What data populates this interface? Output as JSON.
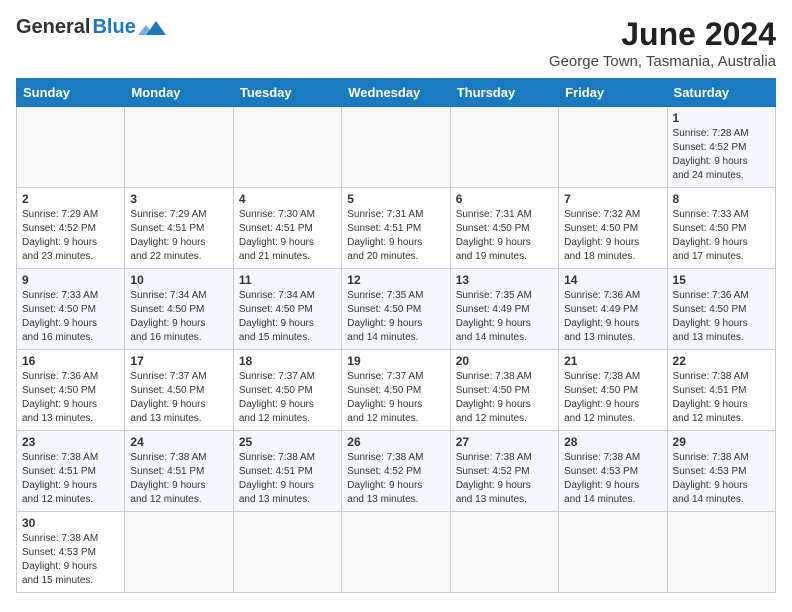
{
  "header": {
    "logo_general": "General",
    "logo_blue": "Blue",
    "title": "June 2024",
    "subtitle": "George Town, Tasmania, Australia"
  },
  "weekdays": [
    "Sunday",
    "Monday",
    "Tuesday",
    "Wednesday",
    "Thursday",
    "Friday",
    "Saturday"
  ],
  "weeks": [
    [
      {
        "day": "",
        "info": ""
      },
      {
        "day": "",
        "info": ""
      },
      {
        "day": "",
        "info": ""
      },
      {
        "day": "",
        "info": ""
      },
      {
        "day": "",
        "info": ""
      },
      {
        "day": "",
        "info": ""
      },
      {
        "day": "1",
        "info": "Sunrise: 7:28 AM\nSunset: 4:52 PM\nDaylight: 9 hours\nand 24 minutes."
      }
    ],
    [
      {
        "day": "2",
        "info": "Sunrise: 7:29 AM\nSunset: 4:52 PM\nDaylight: 9 hours\nand 23 minutes."
      },
      {
        "day": "3",
        "info": "Sunrise: 7:29 AM\nSunset: 4:51 PM\nDaylight: 9 hours\nand 22 minutes."
      },
      {
        "day": "4",
        "info": "Sunrise: 7:30 AM\nSunset: 4:51 PM\nDaylight: 9 hours\nand 21 minutes."
      },
      {
        "day": "5",
        "info": "Sunrise: 7:31 AM\nSunset: 4:51 PM\nDaylight: 9 hours\nand 20 minutes."
      },
      {
        "day": "6",
        "info": "Sunrise: 7:31 AM\nSunset: 4:50 PM\nDaylight: 9 hours\nand 19 minutes."
      },
      {
        "day": "7",
        "info": "Sunrise: 7:32 AM\nSunset: 4:50 PM\nDaylight: 9 hours\nand 18 minutes."
      },
      {
        "day": "8",
        "info": "Sunrise: 7:33 AM\nSunset: 4:50 PM\nDaylight: 9 hours\nand 17 minutes."
      }
    ],
    [
      {
        "day": "9",
        "info": "Sunrise: 7:33 AM\nSunset: 4:50 PM\nDaylight: 9 hours\nand 16 minutes."
      },
      {
        "day": "10",
        "info": "Sunrise: 7:34 AM\nSunset: 4:50 PM\nDaylight: 9 hours\nand 16 minutes."
      },
      {
        "day": "11",
        "info": "Sunrise: 7:34 AM\nSunset: 4:50 PM\nDaylight: 9 hours\nand 15 minutes."
      },
      {
        "day": "12",
        "info": "Sunrise: 7:35 AM\nSunset: 4:50 PM\nDaylight: 9 hours\nand 14 minutes."
      },
      {
        "day": "13",
        "info": "Sunrise: 7:35 AM\nSunset: 4:49 PM\nDaylight: 9 hours\nand 14 minutes."
      },
      {
        "day": "14",
        "info": "Sunrise: 7:36 AM\nSunset: 4:49 PM\nDaylight: 9 hours\nand 13 minutes."
      },
      {
        "day": "15",
        "info": "Sunrise: 7:36 AM\nSunset: 4:50 PM\nDaylight: 9 hours\nand 13 minutes."
      }
    ],
    [
      {
        "day": "16",
        "info": "Sunrise: 7:36 AM\nSunset: 4:50 PM\nDaylight: 9 hours\nand 13 minutes."
      },
      {
        "day": "17",
        "info": "Sunrise: 7:37 AM\nSunset: 4:50 PM\nDaylight: 9 hours\nand 13 minutes."
      },
      {
        "day": "18",
        "info": "Sunrise: 7:37 AM\nSunset: 4:50 PM\nDaylight: 9 hours\nand 12 minutes."
      },
      {
        "day": "19",
        "info": "Sunrise: 7:37 AM\nSunset: 4:50 PM\nDaylight: 9 hours\nand 12 minutes."
      },
      {
        "day": "20",
        "info": "Sunrise: 7:38 AM\nSunset: 4:50 PM\nDaylight: 9 hours\nand 12 minutes."
      },
      {
        "day": "21",
        "info": "Sunrise: 7:38 AM\nSunset: 4:50 PM\nDaylight: 9 hours\nand 12 minutes."
      },
      {
        "day": "22",
        "info": "Sunrise: 7:38 AM\nSunset: 4:51 PM\nDaylight: 9 hours\nand 12 minutes."
      }
    ],
    [
      {
        "day": "23",
        "info": "Sunrise: 7:38 AM\nSunset: 4:51 PM\nDaylight: 9 hours\nand 12 minutes."
      },
      {
        "day": "24",
        "info": "Sunrise: 7:38 AM\nSunset: 4:51 PM\nDaylight: 9 hours\nand 12 minutes."
      },
      {
        "day": "25",
        "info": "Sunrise: 7:38 AM\nSunset: 4:51 PM\nDaylight: 9 hours\nand 13 minutes."
      },
      {
        "day": "26",
        "info": "Sunrise: 7:38 AM\nSunset: 4:52 PM\nDaylight: 9 hours\nand 13 minutes."
      },
      {
        "day": "27",
        "info": "Sunrise: 7:38 AM\nSunset: 4:52 PM\nDaylight: 9 hours\nand 13 minutes."
      },
      {
        "day": "28",
        "info": "Sunrise: 7:38 AM\nSunset: 4:53 PM\nDaylight: 9 hours\nand 14 minutes."
      },
      {
        "day": "29",
        "info": "Sunrise: 7:38 AM\nSunset: 4:53 PM\nDaylight: 9 hours\nand 14 minutes."
      }
    ],
    [
      {
        "day": "30",
        "info": "Sunrise: 7:38 AM\nSunset: 4:53 PM\nDaylight: 9 hours\nand 15 minutes."
      },
      {
        "day": "",
        "info": ""
      },
      {
        "day": "",
        "info": ""
      },
      {
        "day": "",
        "info": ""
      },
      {
        "day": "",
        "info": ""
      },
      {
        "day": "",
        "info": ""
      },
      {
        "day": "",
        "info": ""
      }
    ]
  ]
}
